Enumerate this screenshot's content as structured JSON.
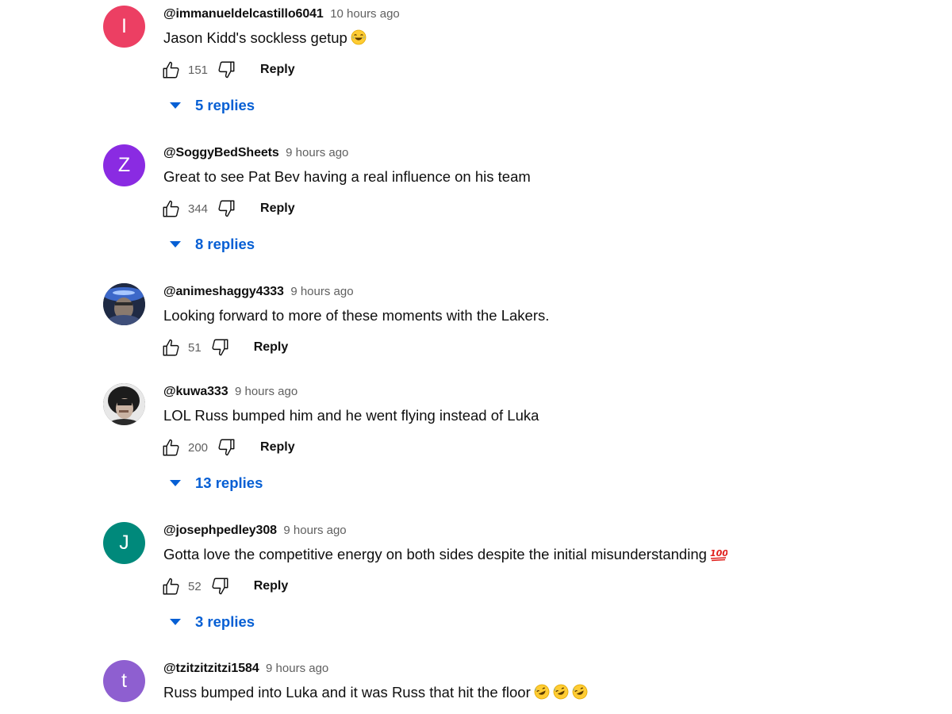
{
  "comments": [
    {
      "author": "@immanueldelcastillo6041",
      "time": "10 hours ago",
      "text": "Jason Kidd's sockless getup",
      "emoji": [
        "😂"
      ],
      "avatar": {
        "type": "letter",
        "letter": "I",
        "color": "#ec3f63"
      },
      "likes": "151",
      "reply_label": "Reply",
      "replies": "5 replies"
    },
    {
      "author": "@SoggyBedSheets",
      "time": "9 hours ago",
      "text": "Great to see Pat Bev having a real influence on his team",
      "emoji": [],
      "avatar": {
        "type": "letter",
        "letter": "Z",
        "color": "#8a2be2"
      },
      "likes": "344",
      "reply_label": "Reply",
      "replies": "8 replies"
    },
    {
      "author": "@animeshaggy4333",
      "time": "9 hours ago",
      "text": "Looking forward to more of these moments with the Lakers.",
      "emoji": [],
      "avatar": {
        "type": "photo",
        "subject": "anime-character-photo"
      },
      "likes": "51",
      "reply_label": "Reply",
      "replies": ""
    },
    {
      "author": "@kuwa333",
      "time": "9 hours ago",
      "text": "LOL Russ bumped him and he went flying instead of Luka",
      "emoji": [],
      "avatar": {
        "type": "photo",
        "subject": "person-photo"
      },
      "likes": "200",
      "reply_label": "Reply",
      "replies": "13 replies"
    },
    {
      "author": "@josephpedley308",
      "time": "9 hours ago",
      "text": "Gotta love the competitive energy on both sides despite the initial misunderstanding",
      "emoji": [
        "💯"
      ],
      "avatar": {
        "type": "letter",
        "letter": "J",
        "color": "#00897b"
      },
      "likes": "52",
      "reply_label": "Reply",
      "replies": "3 replies"
    },
    {
      "author": "@tzitzitzitzi1584",
      "time": "9 hours ago",
      "text": "Russ bumped into Luka and it was Russ that hit the floor",
      "emoji": [
        "🤣",
        "🤣",
        "🤣"
      ],
      "avatar": {
        "type": "letter",
        "letter": "t",
        "color": "#8e5fd0"
      },
      "likes": "",
      "reply_label": "",
      "replies": ""
    }
  ],
  "icons": {
    "like": "thumbs-up-icon",
    "dislike": "thumbs-down-icon",
    "expand": "caret-down-icon"
  },
  "colors": {
    "link_blue": "#065fd4",
    "secondary_text": "#606060"
  }
}
